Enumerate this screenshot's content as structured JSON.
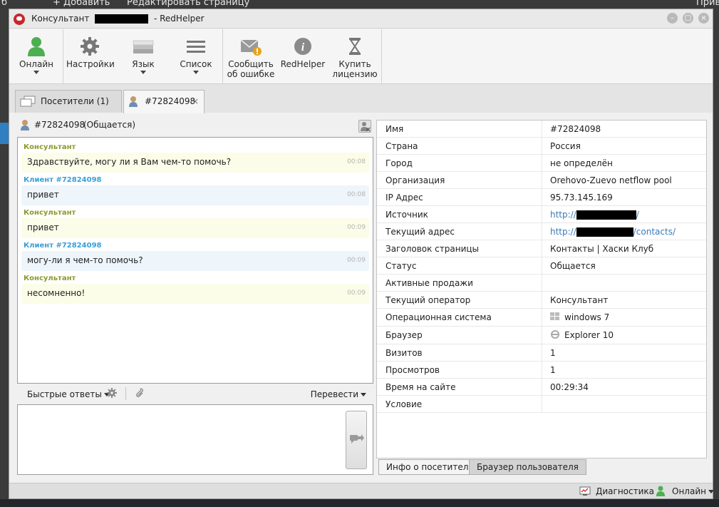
{
  "background": {
    "left_text": "б",
    "add_label": "+ Добавить",
    "edit_label": "Редактировать страницу",
    "right_text": "Приве"
  },
  "window": {
    "title_prefix": "Консультант",
    "title_suffix": "- RedHelper"
  },
  "toolbar": {
    "online": "Онлайн",
    "settings": "Настройки",
    "language": "Язык",
    "list": "Список",
    "report_line1": "Сообщить",
    "report_line2": "об ошибке",
    "redhelper": "RedHelper",
    "buy_line1": "Купить",
    "buy_line2": "лицензию"
  },
  "tabs": {
    "visitors": "Посетители (1)",
    "chat": "#72824098",
    "close": "×"
  },
  "chat": {
    "visitor_id": "#72824098",
    "status": "(Общается)",
    "messages": [
      {
        "author": "Консультант",
        "text": "Здравствуйте, могу ли я Вам чем-то помочь?",
        "time": "00:08"
      },
      {
        "author": "Клиент #72824098",
        "text": "привет",
        "time": "00:08"
      },
      {
        "author": "Консультант",
        "text": "привет",
        "time": "00:09"
      },
      {
        "author": "Клиент #72824098",
        "text": "могу-ли я чем-то помочь?",
        "time": "00:09"
      },
      {
        "author": "Консультант",
        "text": "несомненно!",
        "time": "00:09"
      }
    ],
    "quick_replies": "Быстрые ответы",
    "translate": "Перевести"
  },
  "info": {
    "rows": [
      {
        "key": "Имя",
        "value": "#72824098"
      },
      {
        "key": "Страна",
        "value": "Россия"
      },
      {
        "key": "Город",
        "value": "не определён"
      },
      {
        "key": "Организация",
        "value": "Orehovo-Zuevo netflow pool"
      },
      {
        "key": "IP Адрес",
        "value": "95.73.145.169"
      },
      {
        "key": "Источник",
        "value_prefix": "http://",
        "value_suffix": "/"
      },
      {
        "key": "Текущий адрес",
        "value_prefix": "http://",
        "value_suffix": "/contacts/"
      },
      {
        "key": "Заголовок страницы",
        "value": "Контакты | Хаски Клуб"
      },
      {
        "key": "Статус",
        "value": "Общается"
      },
      {
        "key": "Активные продажи",
        "value": ""
      },
      {
        "key": "Текущий оператор",
        "value": "Консультант"
      },
      {
        "key": "Операционная система",
        "value": "windows 7"
      },
      {
        "key": "Браузер",
        "value": "Explorer 10"
      },
      {
        "key": "Визитов",
        "value": "1"
      },
      {
        "key": "Просмотров",
        "value": "1"
      },
      {
        "key": "Время на сайте",
        "value": "00:29:34"
      },
      {
        "key": "Условие",
        "value": ""
      }
    ],
    "tab_info": "Инфо о посетителе",
    "tab_browser": "Браузер пользователя"
  },
  "statusbar": {
    "diagnostics": "Диагностика",
    "online": "Онлайн"
  },
  "colors": {
    "operator_author": "#8a9a2a",
    "client_author": "#3a9ed8",
    "link": "#3b7ab8",
    "online_green": "#4caf50"
  }
}
